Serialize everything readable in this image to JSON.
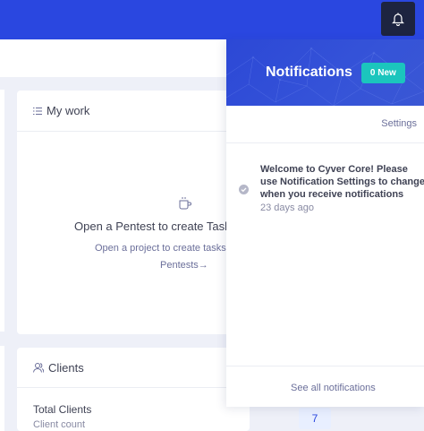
{
  "topbar": {
    "bell_icon": "bell-icon"
  },
  "my_work": {
    "title": "My work",
    "empty_title": "Open a Pentest to create Tasks",
    "empty_subtitle": "Open a project to create tasks on",
    "link_label": "Pentests→"
  },
  "clients": {
    "title": "Clients",
    "total_label": "Total Clients",
    "count_label": "Client count",
    "count_value": "7"
  },
  "notifications": {
    "title": "Notifications",
    "new_badge": "0 New",
    "settings_label": "Settings",
    "items": [
      {
        "text": "Welcome to Cyver Core! Please use Notification Settings to change when you receive notifications",
        "time": "23 days ago"
      }
    ],
    "see_all_label": "See all notifications"
  },
  "colors": {
    "topbar": "#2a47e0",
    "accent_teal": "#1bc5bd",
    "page_bg": "#eef0f8"
  }
}
